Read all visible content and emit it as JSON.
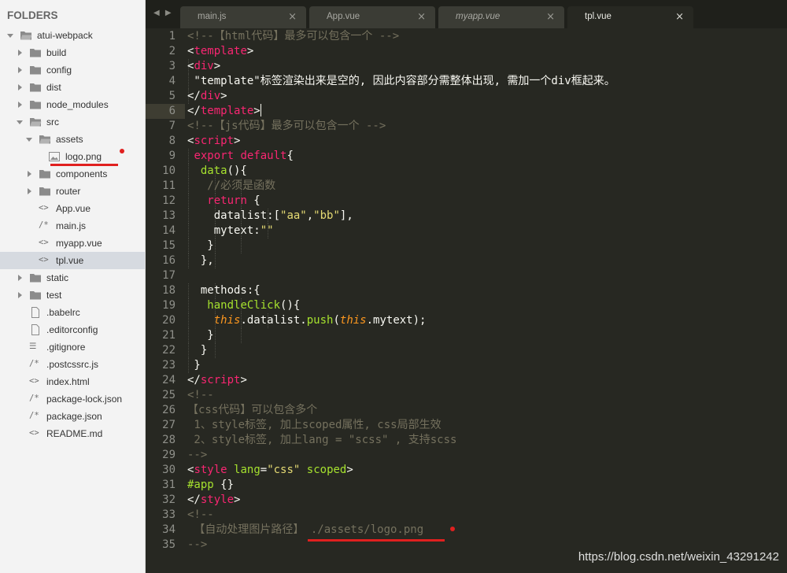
{
  "sidebar": {
    "title": "FOLDERS",
    "items": [
      {
        "label": "atui-webpack",
        "type": "folder",
        "state": "open",
        "depth": 0,
        "icon": "folder-open-icon"
      },
      {
        "label": "build",
        "type": "folder",
        "state": "closed",
        "depth": 1,
        "icon": "folder-icon"
      },
      {
        "label": "config",
        "type": "folder",
        "state": "closed",
        "depth": 1,
        "icon": "folder-icon"
      },
      {
        "label": "dist",
        "type": "folder",
        "state": "closed",
        "depth": 1,
        "icon": "folder-icon"
      },
      {
        "label": "node_modules",
        "type": "folder",
        "state": "closed",
        "depth": 1,
        "icon": "folder-icon"
      },
      {
        "label": "src",
        "type": "folder",
        "state": "open",
        "depth": 1,
        "icon": "folder-open-icon"
      },
      {
        "label": "assets",
        "type": "folder",
        "state": "open",
        "depth": 2,
        "icon": "folder-open-icon"
      },
      {
        "label": "logo.png",
        "type": "file",
        "depth": 3,
        "icon": "image-file-icon",
        "marker": true
      },
      {
        "label": "components",
        "type": "folder",
        "state": "closed",
        "depth": 2,
        "icon": "folder-icon"
      },
      {
        "label": "router",
        "type": "folder",
        "state": "closed",
        "depth": 2,
        "icon": "folder-icon"
      },
      {
        "label": "App.vue",
        "type": "file",
        "depth": 2,
        "icon": "code-file-icon",
        "glyph": "<>"
      },
      {
        "label": "main.js",
        "type": "file",
        "depth": 2,
        "icon": "script-file-icon",
        "glyph": "/*"
      },
      {
        "label": "myapp.vue",
        "type": "file",
        "depth": 2,
        "icon": "code-file-icon",
        "glyph": "<>"
      },
      {
        "label": "tpl.vue",
        "type": "file",
        "depth": 2,
        "icon": "code-file-icon",
        "glyph": "<>",
        "selected": true
      },
      {
        "label": "static",
        "type": "folder",
        "state": "closed",
        "depth": 1,
        "icon": "folder-icon"
      },
      {
        "label": "test",
        "type": "folder",
        "state": "closed",
        "depth": 1,
        "icon": "folder-icon"
      },
      {
        "label": ".babelrc",
        "type": "file",
        "depth": 1,
        "icon": "document-file-icon"
      },
      {
        "label": ".editorconfig",
        "type": "file",
        "depth": 1,
        "icon": "document-file-icon"
      },
      {
        "label": ".gitignore",
        "type": "file",
        "depth": 1,
        "icon": "list-file-icon",
        "glyph": "☰"
      },
      {
        "label": ".postcssrc.js",
        "type": "file",
        "depth": 1,
        "icon": "script-file-icon",
        "glyph": "/*"
      },
      {
        "label": "index.html",
        "type": "file",
        "depth": 1,
        "icon": "code-file-icon",
        "glyph": "<>"
      },
      {
        "label": "package-lock.json",
        "type": "file",
        "depth": 1,
        "icon": "script-file-icon",
        "glyph": "/*"
      },
      {
        "label": "package.json",
        "type": "file",
        "depth": 1,
        "icon": "script-file-icon",
        "glyph": "/*"
      },
      {
        "label": "README.md",
        "type": "file",
        "depth": 1,
        "icon": "code-file-icon",
        "glyph": "<>"
      }
    ]
  },
  "tabs": {
    "nav": "◀ ▶",
    "items": [
      {
        "label": "main.js",
        "close": "×",
        "italic": false,
        "active": false
      },
      {
        "label": "App.vue",
        "close": "×",
        "italic": false,
        "active": false
      },
      {
        "label": "myapp.vue",
        "close": "×",
        "italic": true,
        "active": false
      },
      {
        "label": "tpl.vue",
        "close": "×",
        "italic": false,
        "active": true
      }
    ]
  },
  "editor": {
    "current_line": 6,
    "lines": [
      {
        "n": "1",
        "indent": 0,
        "tokens": [
          [
            "comment",
            "<!--【html代码】最多可以包含一个 -->"
          ]
        ]
      },
      {
        "n": "2",
        "indent": 0,
        "tokens": [
          [
            "plain",
            "<"
          ],
          [
            "tag",
            "template"
          ],
          [
            "plain",
            ">"
          ]
        ]
      },
      {
        "n": "3",
        "indent": 1,
        "tokens": [
          [
            "plain",
            "<"
          ],
          [
            "tag",
            "div"
          ],
          [
            "plain",
            ">"
          ]
        ]
      },
      {
        "n": "4",
        "indent": 1,
        "tokens": [
          [
            "plain",
            " \"template\"标签渲染出来是空的, 因此内容部分需整体出现, 需加一个div框起来。"
          ]
        ]
      },
      {
        "n": "5",
        "indent": 1,
        "tokens": [
          [
            "plain",
            "</"
          ],
          [
            "tag",
            "div"
          ],
          [
            "plain",
            ">"
          ]
        ]
      },
      {
        "n": "6",
        "indent": 0,
        "tokens": [
          [
            "plain",
            "</"
          ],
          [
            "tag",
            "template"
          ],
          [
            "plain",
            ">"
          ]
        ],
        "cursor": true
      },
      {
        "n": "7",
        "indent": 0,
        "tokens": [
          [
            "comment",
            "<!--【js代码】最多可以包含一个 -->"
          ]
        ]
      },
      {
        "n": "8",
        "indent": 0,
        "tokens": [
          [
            "plain",
            "<"
          ],
          [
            "tag",
            "script"
          ],
          [
            "plain",
            ">"
          ]
        ]
      },
      {
        "n": "9",
        "indent": 1,
        "tokens": [
          [
            "plain",
            " "
          ],
          [
            "kw",
            "export default"
          ],
          [
            "plain",
            "{"
          ]
        ]
      },
      {
        "n": "10",
        "indent": 2,
        "tokens": [
          [
            "plain",
            "  "
          ],
          [
            "fn",
            "data"
          ],
          [
            "plain",
            "(){"
          ]
        ]
      },
      {
        "n": "11",
        "indent": 3,
        "tokens": [
          [
            "plain",
            "   "
          ],
          [
            "comment",
            "//必须是函数"
          ]
        ]
      },
      {
        "n": "12",
        "indent": 3,
        "tokens": [
          [
            "plain",
            "   "
          ],
          [
            "kw",
            "return"
          ],
          [
            "plain",
            " {"
          ]
        ]
      },
      {
        "n": "13",
        "indent": 4,
        "tokens": [
          [
            "plain",
            "    datalist:["
          ],
          [
            "str",
            "\"aa\""
          ],
          [
            "plain",
            ","
          ],
          [
            "str",
            "\"bb\""
          ],
          [
            "plain",
            "],"
          ]
        ]
      },
      {
        "n": "14",
        "indent": 4,
        "tokens": [
          [
            "plain",
            "    mytext:"
          ],
          [
            "str",
            "\"\""
          ]
        ]
      },
      {
        "n": "15",
        "indent": 3,
        "tokens": [
          [
            "plain",
            "   }"
          ]
        ]
      },
      {
        "n": "16",
        "indent": 2,
        "tokens": [
          [
            "plain",
            "  },"
          ]
        ]
      },
      {
        "n": "17",
        "indent": 0,
        "tokens": [
          [
            "plain",
            ""
          ]
        ]
      },
      {
        "n": "18",
        "indent": 2,
        "tokens": [
          [
            "plain",
            "  methods:{"
          ]
        ]
      },
      {
        "n": "19",
        "indent": 3,
        "tokens": [
          [
            "plain",
            "   "
          ],
          [
            "fn",
            "handleClick"
          ],
          [
            "plain",
            "(){"
          ]
        ]
      },
      {
        "n": "20",
        "indent": 4,
        "tokens": [
          [
            "plain",
            "    "
          ],
          [
            "this",
            "this"
          ],
          [
            "plain",
            ".datalist."
          ],
          [
            "fn",
            "push"
          ],
          [
            "plain",
            "("
          ],
          [
            "this",
            "this"
          ],
          [
            "plain",
            ".mytext);"
          ]
        ]
      },
      {
        "n": "21",
        "indent": 3,
        "tokens": [
          [
            "plain",
            "   }"
          ]
        ]
      },
      {
        "n": "22",
        "indent": 2,
        "tokens": [
          [
            "plain",
            "  }"
          ]
        ]
      },
      {
        "n": "23",
        "indent": 1,
        "tokens": [
          [
            "plain",
            " }"
          ]
        ]
      },
      {
        "n": "24",
        "indent": 0,
        "tokens": [
          [
            "plain",
            "</"
          ],
          [
            "tag",
            "script"
          ],
          [
            "plain",
            ">"
          ]
        ]
      },
      {
        "n": "25",
        "indent": 0,
        "tokens": [
          [
            "comment",
            "<!--"
          ]
        ]
      },
      {
        "n": "26",
        "indent": 0,
        "tokens": [
          [
            "comment",
            "【css代码】可以包含多个"
          ]
        ]
      },
      {
        "n": "27",
        "indent": 0,
        "tokens": [
          [
            "comment",
            " 1、style标签, 加上scoped属性, css局部生效"
          ]
        ]
      },
      {
        "n": "28",
        "indent": 0,
        "tokens": [
          [
            "comment",
            " 2、style标签, 加上lang = \"scss\" , 支持scss"
          ]
        ]
      },
      {
        "n": "29",
        "indent": 0,
        "tokens": [
          [
            "comment",
            "-->"
          ]
        ]
      },
      {
        "n": "30",
        "indent": 0,
        "tokens": [
          [
            "plain",
            "<"
          ],
          [
            "tag",
            "style"
          ],
          [
            "plain",
            " "
          ],
          [
            "attr",
            "lang"
          ],
          [
            "plain",
            "="
          ],
          [
            "str",
            "\"css\""
          ],
          [
            "plain",
            " "
          ],
          [
            "attr",
            "scoped"
          ],
          [
            "plain",
            ">"
          ]
        ]
      },
      {
        "n": "31",
        "indent": 0,
        "tokens": [
          [
            "attr",
            "#app"
          ],
          [
            "plain",
            " {}"
          ]
        ]
      },
      {
        "n": "32",
        "indent": 0,
        "tokens": [
          [
            "plain",
            "</"
          ],
          [
            "tag",
            "style"
          ],
          [
            "plain",
            ">"
          ]
        ]
      },
      {
        "n": "33",
        "indent": 0,
        "tokens": [
          [
            "comment",
            "<!--"
          ]
        ]
      },
      {
        "n": "34",
        "indent": 0,
        "tokens": [
          [
            "comment",
            " 【自动处理图片路径】 ./assets/logo.png"
          ]
        ],
        "marker": true
      },
      {
        "n": "35",
        "indent": 0,
        "tokens": [
          [
            "comment",
            "-->"
          ]
        ]
      }
    ]
  },
  "watermark": "https://blog.csdn.net/weixin_43291242",
  "colors": {
    "editor_bg": "#272822",
    "sidebar_bg": "#f3f3f3",
    "tag": "#f92672",
    "string": "#e6db74",
    "function": "#a6e22e",
    "comment": "#75715e",
    "this": "#fd971f",
    "annotation_red": "#e0201f"
  }
}
